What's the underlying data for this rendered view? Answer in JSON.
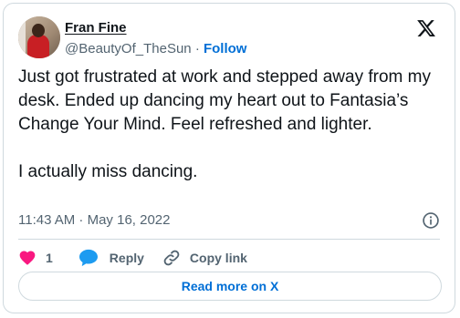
{
  "author": {
    "name": "Fran Fine",
    "handle": "@BeautyOf_TheSun",
    "separator": "·",
    "follow_label": "Follow"
  },
  "tweet": {
    "text": "Just got frustrated at work and stepped away from my desk. Ended up dancing my heart out to Fantasia’s Change Your Mind. Feel refreshed and lighter.\n\nI actually miss dancing.",
    "timestamp": "11:43 AM · May 16, 2022"
  },
  "actions": {
    "like_count": "1",
    "reply_label": "Reply",
    "copy_link_label": "Copy link"
  },
  "read_more_label": "Read more on X",
  "icons": {
    "brand": "x-logo-icon",
    "info": "info-icon",
    "like": "heart-icon",
    "reply": "speech-bubble-icon",
    "copy": "link-icon"
  },
  "colors": {
    "like": "#f91880",
    "reply": "#1d9bf0",
    "link": "#006fd6",
    "muted": "#536471",
    "border": "#cfd9de"
  }
}
